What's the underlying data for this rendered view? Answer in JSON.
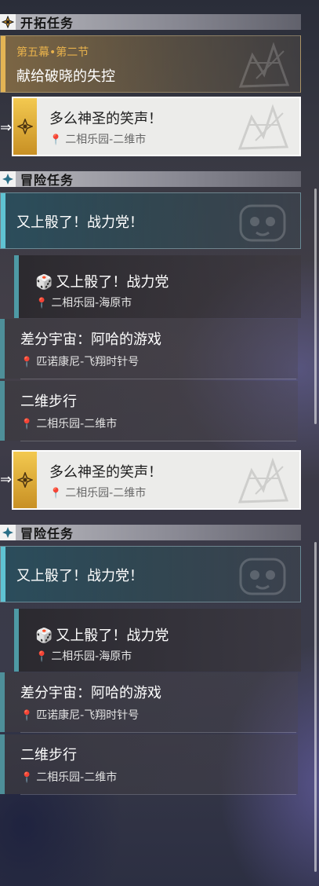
{
  "trailblaze": {
    "header": "开拓任务",
    "card": {
      "subtitle": "第五幕•第二节",
      "title": "献给破晓的失控"
    }
  },
  "selected_mission": {
    "title": "多么神圣的笑声！",
    "location": "二相乐园-二维市"
  },
  "adventure": {
    "header": "冒险任务",
    "group_title": "又上骰了！战力党！",
    "step": {
      "title": "又上骰了！战力党",
      "location": "二相乐园-海原市"
    },
    "items": [
      {
        "title": "差分宇宙：阿哈的游戏",
        "location": "匹诺康尼-飞翔时针号"
      },
      {
        "title": "二维步行",
        "location": "二相乐园-二维市"
      }
    ]
  },
  "colors": {
    "trailblaze_accent": "#e3b454",
    "adventure_accent": "#5fc3d3",
    "selected_bg": "#ececea"
  },
  "icons": {
    "location": "map-pin-icon",
    "trailblaze": "trailblaze-emblem-icon",
    "adventure": "diamond-star-icon",
    "dice": "dice-icon"
  }
}
